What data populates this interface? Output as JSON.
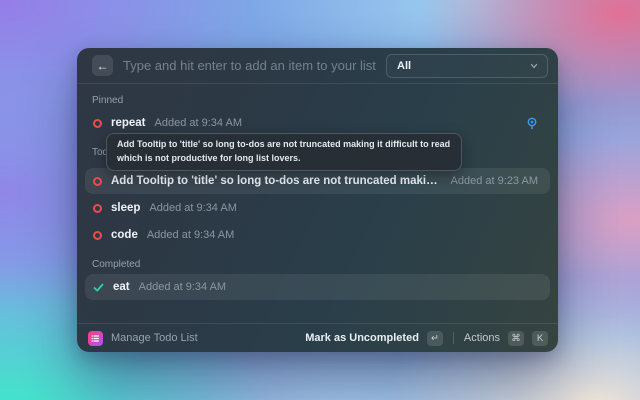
{
  "header": {
    "search_placeholder": "Type and hit enter to add an item to your list...",
    "filter_value": "All"
  },
  "list": {
    "tooltip_text": "Add Tooltip to 'title' so long to-dos are not truncated making it difficult to read which is not productive for long list lovers.",
    "pinned": {
      "label": "Pinned",
      "items": [
        {
          "title": "repeat",
          "subtitle": "Added at 9:34 AM",
          "status": "todo",
          "pinned": true
        }
      ]
    },
    "todos": {
      "label": "Todos",
      "items": [
        {
          "title": "Add Tooltip to 'title' so long to-dos are not truncated making it difficult to read which is...",
          "subtitle": "Added at 9:23 AM",
          "status": "todo",
          "hovered": true
        },
        {
          "title": "sleep",
          "subtitle": "Added at 9:34 AM",
          "status": "todo"
        },
        {
          "title": "code",
          "subtitle": "Added at 9:34 AM",
          "status": "todo"
        }
      ]
    },
    "completed": {
      "label": "Completed",
      "items": [
        {
          "title": "eat",
          "subtitle": "Added at 9:34 AM",
          "status": "done",
          "selected": true
        }
      ]
    }
  },
  "footer": {
    "app_name": "Manage Todo List",
    "primary_action": "Mark as Uncompleted",
    "primary_key": "↵",
    "actions_label": "Actions",
    "actions_key_1": "⌘",
    "actions_key_2": "K"
  },
  "icons": {
    "back": "←",
    "chevron_down": "chevron-down",
    "todo_circle": "red-circle-outline",
    "done_check": "teal-checkmark",
    "pin": "blue-pin"
  },
  "colors": {
    "todo_accent": "#ef4a50",
    "done_accent": "#25d6ab",
    "pin_accent": "#3f97f7",
    "app_icon_gradient": [
      "#f43f8e",
      "#a855f7"
    ]
  }
}
